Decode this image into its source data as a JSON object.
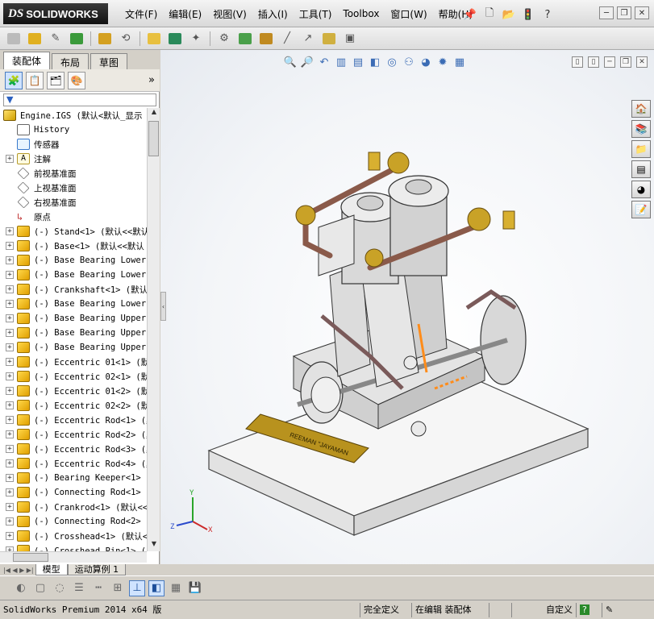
{
  "app": {
    "logo_prefix": "DS",
    "logo_name": "SOLIDWORKS"
  },
  "menu": [
    "文件(F)",
    "编辑(E)",
    "视图(V)",
    "插入(I)",
    "工具(T)",
    "Toolbox",
    "窗口(W)",
    "帮助(H)"
  ],
  "title_icons": [
    "pin-icon",
    "new-icon",
    "open-icon",
    "traffic-light-icon",
    "help-icon"
  ],
  "left_tabs": [
    "装配体",
    "布局",
    "草图"
  ],
  "tree_root": "Engine.IGS  (默认<默认_显示",
  "tree": [
    {
      "icon": "hist",
      "label": "History",
      "exp": false
    },
    {
      "icon": "sensor",
      "label": "传感器",
      "exp": false
    },
    {
      "icon": "note",
      "label": "注解",
      "exp": true
    },
    {
      "icon": "plane",
      "label": "前视基准面",
      "exp": false
    },
    {
      "icon": "plane",
      "label": "上视基准面",
      "exp": false
    },
    {
      "icon": "plane",
      "label": "右视基准面",
      "exp": false
    },
    {
      "icon": "origin",
      "label": "原点",
      "exp": false
    },
    {
      "icon": "part",
      "label": "(-) Stand<1> (默认<<默认",
      "exp": true
    },
    {
      "icon": "part",
      "label": "(-) Base<1> (默认<<默认",
      "exp": true
    },
    {
      "icon": "part",
      "label": "(-) Base Bearing Lower",
      "exp": true
    },
    {
      "icon": "part",
      "label": "(-) Base Bearing Lower",
      "exp": true
    },
    {
      "icon": "part",
      "label": "(-) Crankshaft<1> (默认",
      "exp": true
    },
    {
      "icon": "part",
      "label": "(-) Base Bearing Lower",
      "exp": true
    },
    {
      "icon": "part",
      "label": "(-) Base Bearing Upper",
      "exp": true
    },
    {
      "icon": "part",
      "label": "(-) Base Bearing Upper",
      "exp": true
    },
    {
      "icon": "part",
      "label": "(-) Base Bearing Upper",
      "exp": true
    },
    {
      "icon": "part",
      "label": "(-) Eccentric 01<1> (默",
      "exp": true
    },
    {
      "icon": "part",
      "label": "(-) Eccentric 02<1> (默",
      "exp": true
    },
    {
      "icon": "part",
      "label": "(-) Eccentric 01<2> (默",
      "exp": true
    },
    {
      "icon": "part",
      "label": "(-) Eccentric 02<2> (默",
      "exp": true
    },
    {
      "icon": "part",
      "label": "(-) Eccentric Rod<1> (默",
      "exp": true
    },
    {
      "icon": "part",
      "label": "(-) Eccentric Rod<2> (默",
      "exp": true
    },
    {
      "icon": "part",
      "label": "(-) Eccentric Rod<3> (默",
      "exp": true
    },
    {
      "icon": "part",
      "label": "(-) Eccentric Rod<4> (默",
      "exp": true
    },
    {
      "icon": "part",
      "label": "(-) Bearing Keeper<1> (",
      "exp": true
    },
    {
      "icon": "part",
      "label": "(-) Connecting Rod<1> (",
      "exp": true
    },
    {
      "icon": "part",
      "label": "(-) Crankrod<1> (默认<<",
      "exp": true
    },
    {
      "icon": "part",
      "label": "(-) Connecting Rod<2> (",
      "exp": true
    },
    {
      "icon": "part",
      "label": "(-) Crosshead<1> (默认<",
      "exp": true
    },
    {
      "icon": "part",
      "label": "(-) Crosshead Pin<1> (默",
      "exp": true
    }
  ],
  "bottom_tabs": [
    "模型",
    "运动算例 1"
  ],
  "status": {
    "product": "SolidWorks Premium 2014 x64 版",
    "definition": "完全定义",
    "editing": "在编辑 装配体",
    "units": "自定义",
    "help": "?"
  },
  "plate_text": "REEMAN \"JAYAMAN",
  "triad": {
    "x": "X",
    "y": "Y",
    "z": "Z"
  },
  "colors": {
    "pipe": "#8a5a4a",
    "brass": "#c9a227",
    "metal": "#c8c8c8",
    "base": "#f0f0f0",
    "triad_x": "#cc2a2a",
    "triad_y": "#2aa52a",
    "triad_z": "#2a4acc"
  }
}
